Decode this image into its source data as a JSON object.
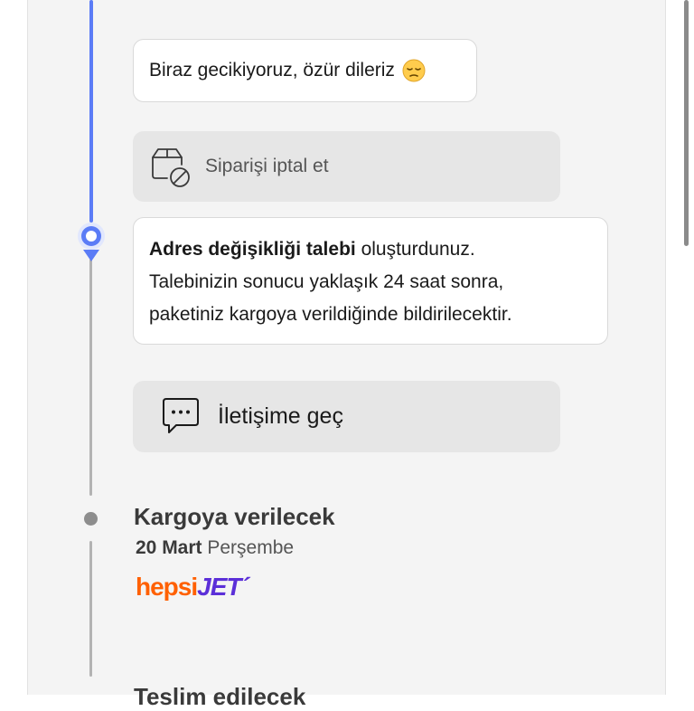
{
  "timeline": {
    "delay_message": "Biraz gecikiyoruz, özür dileriz",
    "delay_emoji": "pensive-face",
    "cancel_action": {
      "label": "Siparişi iptal et",
      "icon": "box-cancel-icon"
    },
    "address_message": {
      "bold": "Adres değişikliği talebi",
      "line1_rest": " oluşturdunuz.",
      "line2": "Talebinizin sonucu yaklaşık 24 saat sonra,",
      "line3": "paketiniz kargoya verildiğinde bildirilecektir."
    },
    "contact_action": {
      "label": "İletişime geç",
      "icon": "chat-bubble-icon"
    },
    "steps": [
      {
        "title": "Kargoya verilecek",
        "date": "20 Mart",
        "weekday": "Perşembe",
        "carrier": {
          "part1": "hepsi",
          "part2": "JET",
          "mark": "´"
        }
      },
      {
        "title": "Teslim edilecek"
      }
    ]
  },
  "colors": {
    "accent_blue": "#5b7cf6",
    "timeline_gray": "#b3b3b3",
    "brand_orange": "#ff6000",
    "brand_purple": "#5b2fd8",
    "panel_bg": "#f4f4f4"
  }
}
